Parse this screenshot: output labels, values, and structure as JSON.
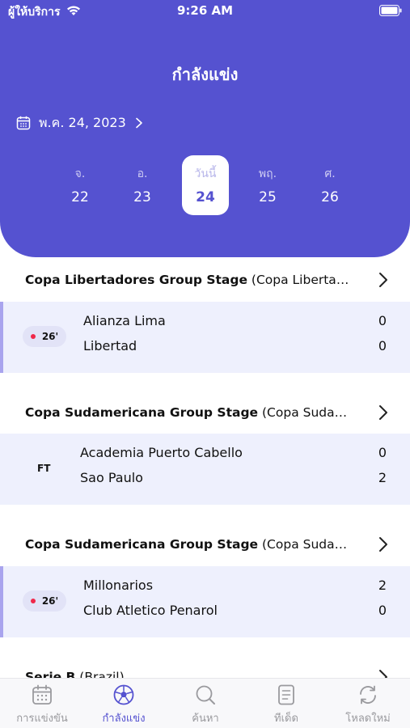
{
  "status_bar": {
    "carrier": "ผู้ให้บริการ",
    "time": "9:26 AM"
  },
  "header": {
    "title": "กำลังแข่ง",
    "date": "พ.ค. 24, 2023",
    "days": [
      {
        "weekday": "จ.",
        "number": "22",
        "selected": false
      },
      {
        "weekday": "อ.",
        "number": "23",
        "selected": false
      },
      {
        "weekday": "วันนี้",
        "number": "24",
        "selected": true
      },
      {
        "weekday": "พฤ.",
        "number": "25",
        "selected": false
      },
      {
        "weekday": "ศ.",
        "number": "26",
        "selected": false
      }
    ]
  },
  "sections": [
    {
      "league_bold": "Copa Libertadores Group Stage",
      "league_rest": " (Copa Libertadores)",
      "status": "26'",
      "live": true,
      "home": "Alianza Lima",
      "home_score": "0",
      "away": "Libertad",
      "away_score": "0"
    },
    {
      "league_bold": "Copa Sudamericana Group Stage",
      "league_rest": " (Copa Sudamericana)",
      "status": "FT",
      "live": false,
      "home": "Academia Puerto Cabello",
      "home_score": "0",
      "away": "Sao Paulo",
      "away_score": "2"
    },
    {
      "league_bold": "Copa Sudamericana Group Stage",
      "league_rest": " (Copa Sudamericana)",
      "status": "26'",
      "live": true,
      "home": "Millonarios",
      "home_score": "2",
      "away": "Club Atletico Penarol",
      "away_score": "0"
    },
    {
      "league_bold": "Serie B",
      "league_rest": " (Brazil)"
    }
  ],
  "tabs": [
    {
      "label": "การแข่งขัน",
      "icon": "calendar-icon",
      "active": false
    },
    {
      "label": "กำลังแข่ง",
      "icon": "soccer-ball-icon",
      "active": true
    },
    {
      "label": "ค้นหา",
      "icon": "search-icon",
      "active": false
    },
    {
      "label": "ทีเด็ด",
      "icon": "document-icon",
      "active": false
    },
    {
      "label": "โหลดใหม่",
      "icon": "refresh-icon",
      "active": false
    }
  ],
  "colors": {
    "accent": "#5552d0",
    "card_bg": "#eef0fd",
    "live_dot": "#f0284a"
  }
}
